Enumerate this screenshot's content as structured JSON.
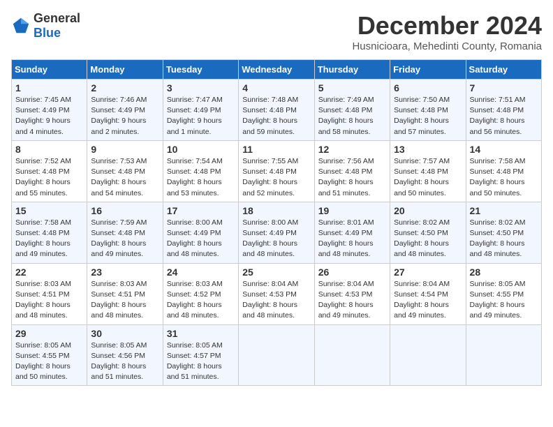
{
  "header": {
    "logo_general": "General",
    "logo_blue": "Blue",
    "month_title": "December 2024",
    "subtitle": "Husnicioara, Mehedinti County, Romania"
  },
  "days_of_week": [
    "Sunday",
    "Monday",
    "Tuesday",
    "Wednesday",
    "Thursday",
    "Friday",
    "Saturday"
  ],
  "weeks": [
    [
      {
        "day": 1,
        "lines": [
          "Sunrise: 7:45 AM",
          "Sunset: 4:49 PM",
          "Daylight: 9 hours",
          "and 4 minutes."
        ]
      },
      {
        "day": 2,
        "lines": [
          "Sunrise: 7:46 AM",
          "Sunset: 4:49 PM",
          "Daylight: 9 hours",
          "and 2 minutes."
        ]
      },
      {
        "day": 3,
        "lines": [
          "Sunrise: 7:47 AM",
          "Sunset: 4:49 PM",
          "Daylight: 9 hours",
          "and 1 minute."
        ]
      },
      {
        "day": 4,
        "lines": [
          "Sunrise: 7:48 AM",
          "Sunset: 4:48 PM",
          "Daylight: 8 hours",
          "and 59 minutes."
        ]
      },
      {
        "day": 5,
        "lines": [
          "Sunrise: 7:49 AM",
          "Sunset: 4:48 PM",
          "Daylight: 8 hours",
          "and 58 minutes."
        ]
      },
      {
        "day": 6,
        "lines": [
          "Sunrise: 7:50 AM",
          "Sunset: 4:48 PM",
          "Daylight: 8 hours",
          "and 57 minutes."
        ]
      },
      {
        "day": 7,
        "lines": [
          "Sunrise: 7:51 AM",
          "Sunset: 4:48 PM",
          "Daylight: 8 hours",
          "and 56 minutes."
        ]
      }
    ],
    [
      {
        "day": 8,
        "lines": [
          "Sunrise: 7:52 AM",
          "Sunset: 4:48 PM",
          "Daylight: 8 hours",
          "and 55 minutes."
        ]
      },
      {
        "day": 9,
        "lines": [
          "Sunrise: 7:53 AM",
          "Sunset: 4:48 PM",
          "Daylight: 8 hours",
          "and 54 minutes."
        ]
      },
      {
        "day": 10,
        "lines": [
          "Sunrise: 7:54 AM",
          "Sunset: 4:48 PM",
          "Daylight: 8 hours",
          "and 53 minutes."
        ]
      },
      {
        "day": 11,
        "lines": [
          "Sunrise: 7:55 AM",
          "Sunset: 4:48 PM",
          "Daylight: 8 hours",
          "and 52 minutes."
        ]
      },
      {
        "day": 12,
        "lines": [
          "Sunrise: 7:56 AM",
          "Sunset: 4:48 PM",
          "Daylight: 8 hours",
          "and 51 minutes."
        ]
      },
      {
        "day": 13,
        "lines": [
          "Sunrise: 7:57 AM",
          "Sunset: 4:48 PM",
          "Daylight: 8 hours",
          "and 50 minutes."
        ]
      },
      {
        "day": 14,
        "lines": [
          "Sunrise: 7:58 AM",
          "Sunset: 4:48 PM",
          "Daylight: 8 hours",
          "and 50 minutes."
        ]
      }
    ],
    [
      {
        "day": 15,
        "lines": [
          "Sunrise: 7:58 AM",
          "Sunset: 4:48 PM",
          "Daylight: 8 hours",
          "and 49 minutes."
        ]
      },
      {
        "day": 16,
        "lines": [
          "Sunrise: 7:59 AM",
          "Sunset: 4:48 PM",
          "Daylight: 8 hours",
          "and 49 minutes."
        ]
      },
      {
        "day": 17,
        "lines": [
          "Sunrise: 8:00 AM",
          "Sunset: 4:49 PM",
          "Daylight: 8 hours",
          "and 48 minutes."
        ]
      },
      {
        "day": 18,
        "lines": [
          "Sunrise: 8:00 AM",
          "Sunset: 4:49 PM",
          "Daylight: 8 hours",
          "and 48 minutes."
        ]
      },
      {
        "day": 19,
        "lines": [
          "Sunrise: 8:01 AM",
          "Sunset: 4:49 PM",
          "Daylight: 8 hours",
          "and 48 minutes."
        ]
      },
      {
        "day": 20,
        "lines": [
          "Sunrise: 8:02 AM",
          "Sunset: 4:50 PM",
          "Daylight: 8 hours",
          "and 48 minutes."
        ]
      },
      {
        "day": 21,
        "lines": [
          "Sunrise: 8:02 AM",
          "Sunset: 4:50 PM",
          "Daylight: 8 hours",
          "and 48 minutes."
        ]
      }
    ],
    [
      {
        "day": 22,
        "lines": [
          "Sunrise: 8:03 AM",
          "Sunset: 4:51 PM",
          "Daylight: 8 hours",
          "and 48 minutes."
        ]
      },
      {
        "day": 23,
        "lines": [
          "Sunrise: 8:03 AM",
          "Sunset: 4:51 PM",
          "Daylight: 8 hours",
          "and 48 minutes."
        ]
      },
      {
        "day": 24,
        "lines": [
          "Sunrise: 8:03 AM",
          "Sunset: 4:52 PM",
          "Daylight: 8 hours",
          "and 48 minutes."
        ]
      },
      {
        "day": 25,
        "lines": [
          "Sunrise: 8:04 AM",
          "Sunset: 4:53 PM",
          "Daylight: 8 hours",
          "and 48 minutes."
        ]
      },
      {
        "day": 26,
        "lines": [
          "Sunrise: 8:04 AM",
          "Sunset: 4:53 PM",
          "Daylight: 8 hours",
          "and 49 minutes."
        ]
      },
      {
        "day": 27,
        "lines": [
          "Sunrise: 8:04 AM",
          "Sunset: 4:54 PM",
          "Daylight: 8 hours",
          "and 49 minutes."
        ]
      },
      {
        "day": 28,
        "lines": [
          "Sunrise: 8:05 AM",
          "Sunset: 4:55 PM",
          "Daylight: 8 hours",
          "and 49 minutes."
        ]
      }
    ],
    [
      {
        "day": 29,
        "lines": [
          "Sunrise: 8:05 AM",
          "Sunset: 4:55 PM",
          "Daylight: 8 hours",
          "and 50 minutes."
        ]
      },
      {
        "day": 30,
        "lines": [
          "Sunrise: 8:05 AM",
          "Sunset: 4:56 PM",
          "Daylight: 8 hours",
          "and 51 minutes."
        ]
      },
      {
        "day": 31,
        "lines": [
          "Sunrise: 8:05 AM",
          "Sunset: 4:57 PM",
          "Daylight: 8 hours",
          "and 51 minutes."
        ]
      },
      null,
      null,
      null,
      null
    ]
  ]
}
